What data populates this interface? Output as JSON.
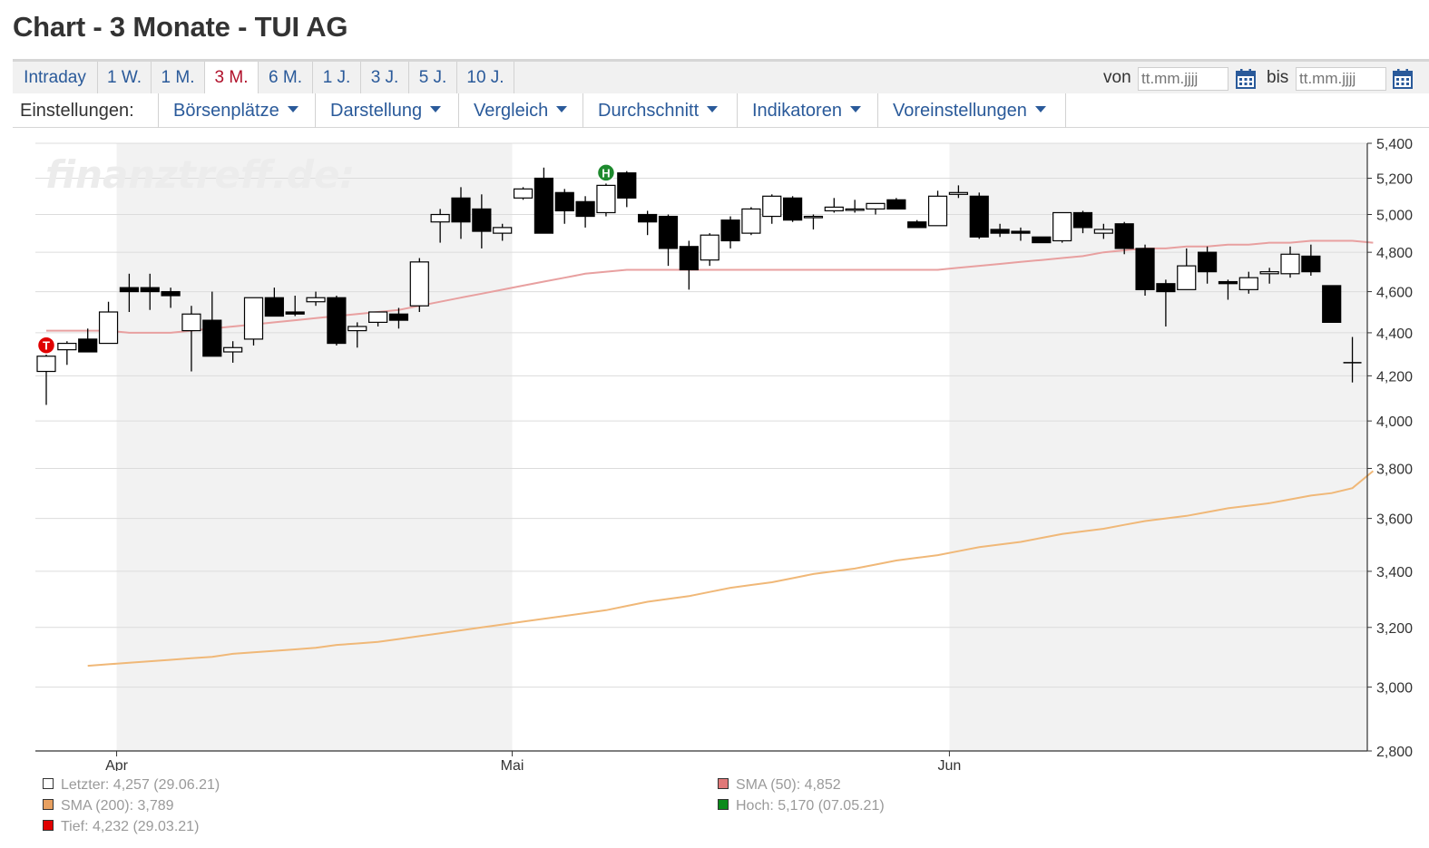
{
  "title": "Chart - 3 Monate - TUI AG",
  "range_tabs": [
    "Intraday",
    "1 W.",
    "1 M.",
    "3 M.",
    "6 M.",
    "1 J.",
    "3 J.",
    "5 J.",
    "10 J."
  ],
  "active_range": "3 M.",
  "date_range": {
    "from_label": "von",
    "to_label": "bis",
    "from_placeholder": "tt.mm.jjjj",
    "to_placeholder": "tt.mm.jjjj"
  },
  "settings": {
    "label": "Einstellungen:",
    "menus": [
      "Börsenplätze",
      "Darstellung",
      "Vergleich",
      "Durchschnitt",
      "Indikatoren",
      "Voreinstellungen"
    ]
  },
  "watermark": "finanztreff.de:",
  "legend": {
    "last": "Letzter: 4,257 (29.06.21)",
    "sma200": "SMA (200): 3,789",
    "low": "Tief: 4,232 (29.03.21)",
    "sma50": "SMA (50): 4,852",
    "high": "Hoch: 5,170 (07.05.21)"
  },
  "colors": {
    "link": "#2a5a9a",
    "active_tab": "#b0102a",
    "sma50": "#e8a0a0",
    "sma200": "#f0b878",
    "marker_high": "#1e8a2e",
    "marker_low": "#e00000",
    "band": "#f2f2f2"
  },
  "chart_data": {
    "type": "candlestick",
    "y_scale": "log",
    "ylim": [
      2.8,
      5.4
    ],
    "y_ticks": [
      "5,400",
      "5,200",
      "5,000",
      "4,800",
      "4,600",
      "4,400",
      "4,200",
      "4,000",
      "3,800",
      "3,600",
      "3,400",
      "3,200",
      "3,000",
      "2,800"
    ],
    "x_tick_labels": [
      "Apr",
      "Mai",
      "Jun"
    ],
    "markers": [
      {
        "label": "T",
        "meaning": "Tief"
      },
      {
        "label": "H",
        "meaning": "Hoch"
      }
    ],
    "candles": [
      {
        "date": "29.03.21",
        "o": 4.22,
        "h": 4.3,
        "l": 4.07,
        "c": 4.29
      },
      {
        "date": "30.03.21",
        "o": 4.32,
        "h": 4.36,
        "l": 4.25,
        "c": 4.35
      },
      {
        "date": "31.03.21",
        "o": 4.37,
        "h": 4.42,
        "l": 4.31,
        "c": 4.31
      },
      {
        "date": "01.04.21",
        "o": 4.35,
        "h": 4.55,
        "l": 4.35,
        "c": 4.5
      },
      {
        "date": "06.04.21",
        "o": 4.62,
        "h": 4.69,
        "l": 4.5,
        "c": 4.6
      },
      {
        "date": "07.04.21",
        "o": 4.62,
        "h": 4.69,
        "l": 4.51,
        "c": 4.6
      },
      {
        "date": "08.04.21",
        "o": 4.6,
        "h": 4.62,
        "l": 4.52,
        "c": 4.58
      },
      {
        "date": "09.04.21",
        "o": 4.41,
        "h": 4.53,
        "l": 4.22,
        "c": 4.49
      },
      {
        "date": "12.04.21",
        "o": 4.46,
        "h": 4.6,
        "l": 4.29,
        "c": 4.29
      },
      {
        "date": "13.04.21",
        "o": 4.31,
        "h": 4.36,
        "l": 4.26,
        "c": 4.33
      },
      {
        "date": "14.04.21",
        "o": 4.37,
        "h": 4.57,
        "l": 4.34,
        "c": 4.57
      },
      {
        "date": "15.04.21",
        "o": 4.57,
        "h": 4.62,
        "l": 4.48,
        "c": 4.48
      },
      {
        "date": "16.04.21",
        "o": 4.5,
        "h": 4.58,
        "l": 4.48,
        "c": 4.49
      },
      {
        "date": "19.04.21",
        "o": 4.55,
        "h": 4.6,
        "l": 4.53,
        "c": 4.57
      },
      {
        "date": "20.04.21",
        "o": 4.57,
        "h": 4.58,
        "l": 4.34,
        "c": 4.35
      },
      {
        "date": "21.04.21",
        "o": 4.41,
        "h": 4.45,
        "l": 4.33,
        "c": 4.43
      },
      {
        "date": "22.04.21",
        "o": 4.45,
        "h": 4.5,
        "l": 4.43,
        "c": 4.5
      },
      {
        "date": "23.04.21",
        "o": 4.49,
        "h": 4.52,
        "l": 4.42,
        "c": 4.46
      },
      {
        "date": "26.04.21",
        "o": 4.53,
        "h": 4.77,
        "l": 4.5,
        "c": 4.75
      },
      {
        "date": "27.04.21",
        "o": 4.96,
        "h": 5.03,
        "l": 4.85,
        "c": 5.0
      },
      {
        "date": "28.04.21",
        "o": 5.09,
        "h": 5.15,
        "l": 4.87,
        "c": 4.96
      },
      {
        "date": "29.04.21",
        "o": 5.03,
        "h": 5.11,
        "l": 4.82,
        "c": 4.91
      },
      {
        "date": "30.04.21",
        "o": 4.9,
        "h": 4.95,
        "l": 4.86,
        "c": 4.93
      },
      {
        "date": "03.05.21",
        "o": 5.09,
        "h": 5.15,
        "l": 5.08,
        "c": 5.14
      },
      {
        "date": "04.05.21",
        "o": 5.2,
        "h": 5.26,
        "l": 4.9,
        "c": 4.9
      },
      {
        "date": "05.05.21",
        "o": 5.12,
        "h": 5.14,
        "l": 4.95,
        "c": 5.02
      },
      {
        "date": "06.05.21",
        "o": 5.07,
        "h": 5.1,
        "l": 4.93,
        "c": 4.99
      },
      {
        "date": "07.05.21",
        "o": 5.01,
        "h": 5.17,
        "l": 4.99,
        "c": 5.16
      },
      {
        "date": "10.05.21",
        "o": 5.23,
        "h": 5.24,
        "l": 5.04,
        "c": 5.09
      },
      {
        "date": "11.05.21",
        "o": 5.0,
        "h": 5.02,
        "l": 4.89,
        "c": 4.96
      },
      {
        "date": "12.05.21",
        "o": 4.99,
        "h": 5.0,
        "l": 4.73,
        "c": 4.82
      },
      {
        "date": "13.05.21",
        "o": 4.83,
        "h": 4.86,
        "l": 4.61,
        "c": 4.71
      },
      {
        "date": "14.05.21",
        "o": 4.76,
        "h": 4.9,
        "l": 4.73,
        "c": 4.89
      },
      {
        "date": "17.05.21",
        "o": 4.97,
        "h": 4.99,
        "l": 4.82,
        "c": 4.86
      },
      {
        "date": "18.05.21",
        "o": 4.9,
        "h": 5.04,
        "l": 4.89,
        "c": 5.03
      },
      {
        "date": "19.05.21",
        "o": 4.99,
        "h": 5.11,
        "l": 4.95,
        "c": 5.1
      },
      {
        "date": "20.05.21",
        "o": 5.09,
        "h": 5.1,
        "l": 4.96,
        "c": 4.97
      },
      {
        "date": "21.05.21",
        "o": 4.99,
        "h": 5.0,
        "l": 4.92,
        "c": 4.99
      },
      {
        "date": "24.05.21",
        "o": 5.02,
        "h": 5.09,
        "l": 5.01,
        "c": 5.04
      },
      {
        "date": "25.05.21",
        "o": 5.03,
        "h": 5.08,
        "l": 5.01,
        "c": 5.03
      },
      {
        "date": "26.05.21",
        "o": 5.03,
        "h": 5.06,
        "l": 5.0,
        "c": 5.06
      },
      {
        "date": "27.05.21",
        "o": 5.08,
        "h": 5.09,
        "l": 5.03,
        "c": 5.03
      },
      {
        "date": "28.05.21",
        "o": 4.96,
        "h": 4.97,
        "l": 4.93,
        "c": 4.93
      },
      {
        "date": "31.05.21",
        "o": 4.94,
        "h": 5.13,
        "l": 4.94,
        "c": 5.1
      },
      {
        "date": "01.06.21",
        "o": 5.11,
        "h": 5.16,
        "l": 5.09,
        "c": 5.12
      },
      {
        "date": "02.06.21",
        "o": 5.1,
        "h": 5.12,
        "l": 4.87,
        "c": 4.88
      },
      {
        "date": "03.06.21",
        "o": 4.92,
        "h": 4.95,
        "l": 4.88,
        "c": 4.9
      },
      {
        "date": "04.06.21",
        "o": 4.91,
        "h": 4.93,
        "l": 4.86,
        "c": 4.9
      },
      {
        "date": "07.06.21",
        "o": 4.88,
        "h": 4.88,
        "l": 4.85,
        "c": 4.85
      },
      {
        "date": "08.06.21",
        "o": 4.86,
        "h": 5.01,
        "l": 4.85,
        "c": 5.01
      },
      {
        "date": "09.06.21",
        "o": 5.01,
        "h": 5.02,
        "l": 4.9,
        "c": 4.93
      },
      {
        "date": "10.06.21",
        "o": 4.9,
        "h": 4.95,
        "l": 4.87,
        "c": 4.92
      },
      {
        "date": "11.06.21",
        "o": 4.95,
        "h": 4.96,
        "l": 4.79,
        "c": 4.82
      },
      {
        "date": "14.06.21",
        "o": 4.82,
        "h": 4.84,
        "l": 4.58,
        "c": 4.61
      },
      {
        "date": "15.06.21",
        "o": 4.64,
        "h": 4.66,
        "l": 4.43,
        "c": 4.6
      },
      {
        "date": "16.06.21",
        "o": 4.61,
        "h": 4.82,
        "l": 4.61,
        "c": 4.73
      },
      {
        "date": "17.06.21",
        "o": 4.8,
        "h": 4.83,
        "l": 4.64,
        "c": 4.7
      },
      {
        "date": "18.06.21",
        "o": 4.65,
        "h": 4.66,
        "l": 4.56,
        "c": 4.64
      },
      {
        "date": "21.06.21",
        "o": 4.61,
        "h": 4.7,
        "l": 4.59,
        "c": 4.67
      },
      {
        "date": "22.06.21",
        "o": 4.69,
        "h": 4.72,
        "l": 4.64,
        "c": 4.7
      },
      {
        "date": "23.06.21",
        "o": 4.69,
        "h": 4.83,
        "l": 4.67,
        "c": 4.79
      },
      {
        "date": "24.06.21",
        "o": 4.78,
        "h": 4.84,
        "l": 4.68,
        "c": 4.7
      },
      {
        "date": "25.06.21",
        "o": 4.63,
        "h": 4.63,
        "l": 4.45,
        "c": 4.45
      },
      {
        "date": "29.06.21",
        "o": 4.26,
        "h": 4.38,
        "l": 4.17,
        "c": 4.26
      }
    ],
    "series": [
      {
        "name": "SMA (50)",
        "values": [
          4.41,
          4.41,
          4.41,
          4.41,
          4.4,
          4.4,
          4.4,
          4.41,
          4.42,
          4.43,
          4.44,
          4.45,
          4.46,
          4.47,
          4.48,
          4.49,
          4.5,
          4.51,
          4.53,
          4.55,
          4.57,
          4.59,
          4.61,
          4.63,
          4.65,
          4.67,
          4.69,
          4.7,
          4.71,
          4.71,
          4.71,
          4.71,
          4.71,
          4.71,
          4.71,
          4.71,
          4.71,
          4.71,
          4.71,
          4.71,
          4.71,
          4.71,
          4.71,
          4.71,
          4.72,
          4.73,
          4.74,
          4.75,
          4.76,
          4.77,
          4.78,
          4.8,
          4.81,
          4.82,
          4.82,
          4.83,
          4.83,
          4.84,
          4.84,
          4.85,
          4.85,
          4.86,
          4.86,
          4.86,
          4.85
        ]
      },
      {
        "name": "SMA (200)",
        "values": [
          null,
          null,
          3.07,
          3.075,
          3.08,
          3.085,
          3.09,
          3.095,
          3.1,
          3.11,
          3.115,
          3.12,
          3.125,
          3.13,
          3.14,
          3.145,
          3.15,
          3.16,
          3.17,
          3.18,
          3.19,
          3.2,
          3.21,
          3.22,
          3.23,
          3.24,
          3.25,
          3.26,
          3.275,
          3.29,
          3.3,
          3.31,
          3.325,
          3.34,
          3.35,
          3.36,
          3.375,
          3.39,
          3.4,
          3.41,
          3.425,
          3.44,
          3.45,
          3.46,
          3.475,
          3.49,
          3.5,
          3.51,
          3.525,
          3.54,
          3.55,
          3.56,
          3.575,
          3.59,
          3.6,
          3.61,
          3.625,
          3.64,
          3.65,
          3.66,
          3.675,
          3.69,
          3.7,
          3.72,
          3.789
        ]
      }
    ]
  }
}
